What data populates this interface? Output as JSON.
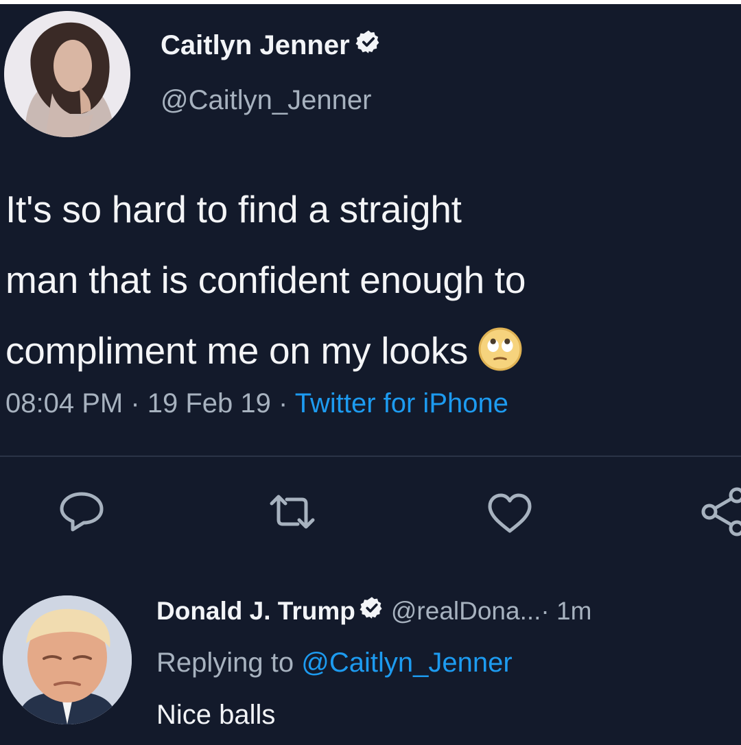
{
  "tweet": {
    "author_name": "Caitlyn Jenner",
    "author_handle": "@Caitlyn_Jenner",
    "verified": true,
    "text_lines": [
      "It's so hard to find a straight",
      "man that is confident enough to",
      "compliment me on my looks"
    ],
    "emoji": "face-with-rolling-eyes-emoji",
    "time": "08:04 PM",
    "separator": " · ",
    "date": "19 Feb 19",
    "source": "Twitter for iPhone"
  },
  "actions": {
    "icons": [
      "reply-icon",
      "retweet-icon",
      "like-icon",
      "share-icon"
    ]
  },
  "reply": {
    "author_name": "Donald J. Trump",
    "verified": true,
    "author_handle": "@realDona...",
    "time_suffix": " · 1m",
    "replying_prefix": "Replying to ",
    "replying_to": "@Caitlyn_Jenner",
    "text": "Nice balls"
  },
  "colors": {
    "background": "#131a2b",
    "text": "#f2f4f7",
    "secondary_text": "#a7b2bf",
    "accent": "#1d9bf0",
    "divider": "#2b3447"
  }
}
